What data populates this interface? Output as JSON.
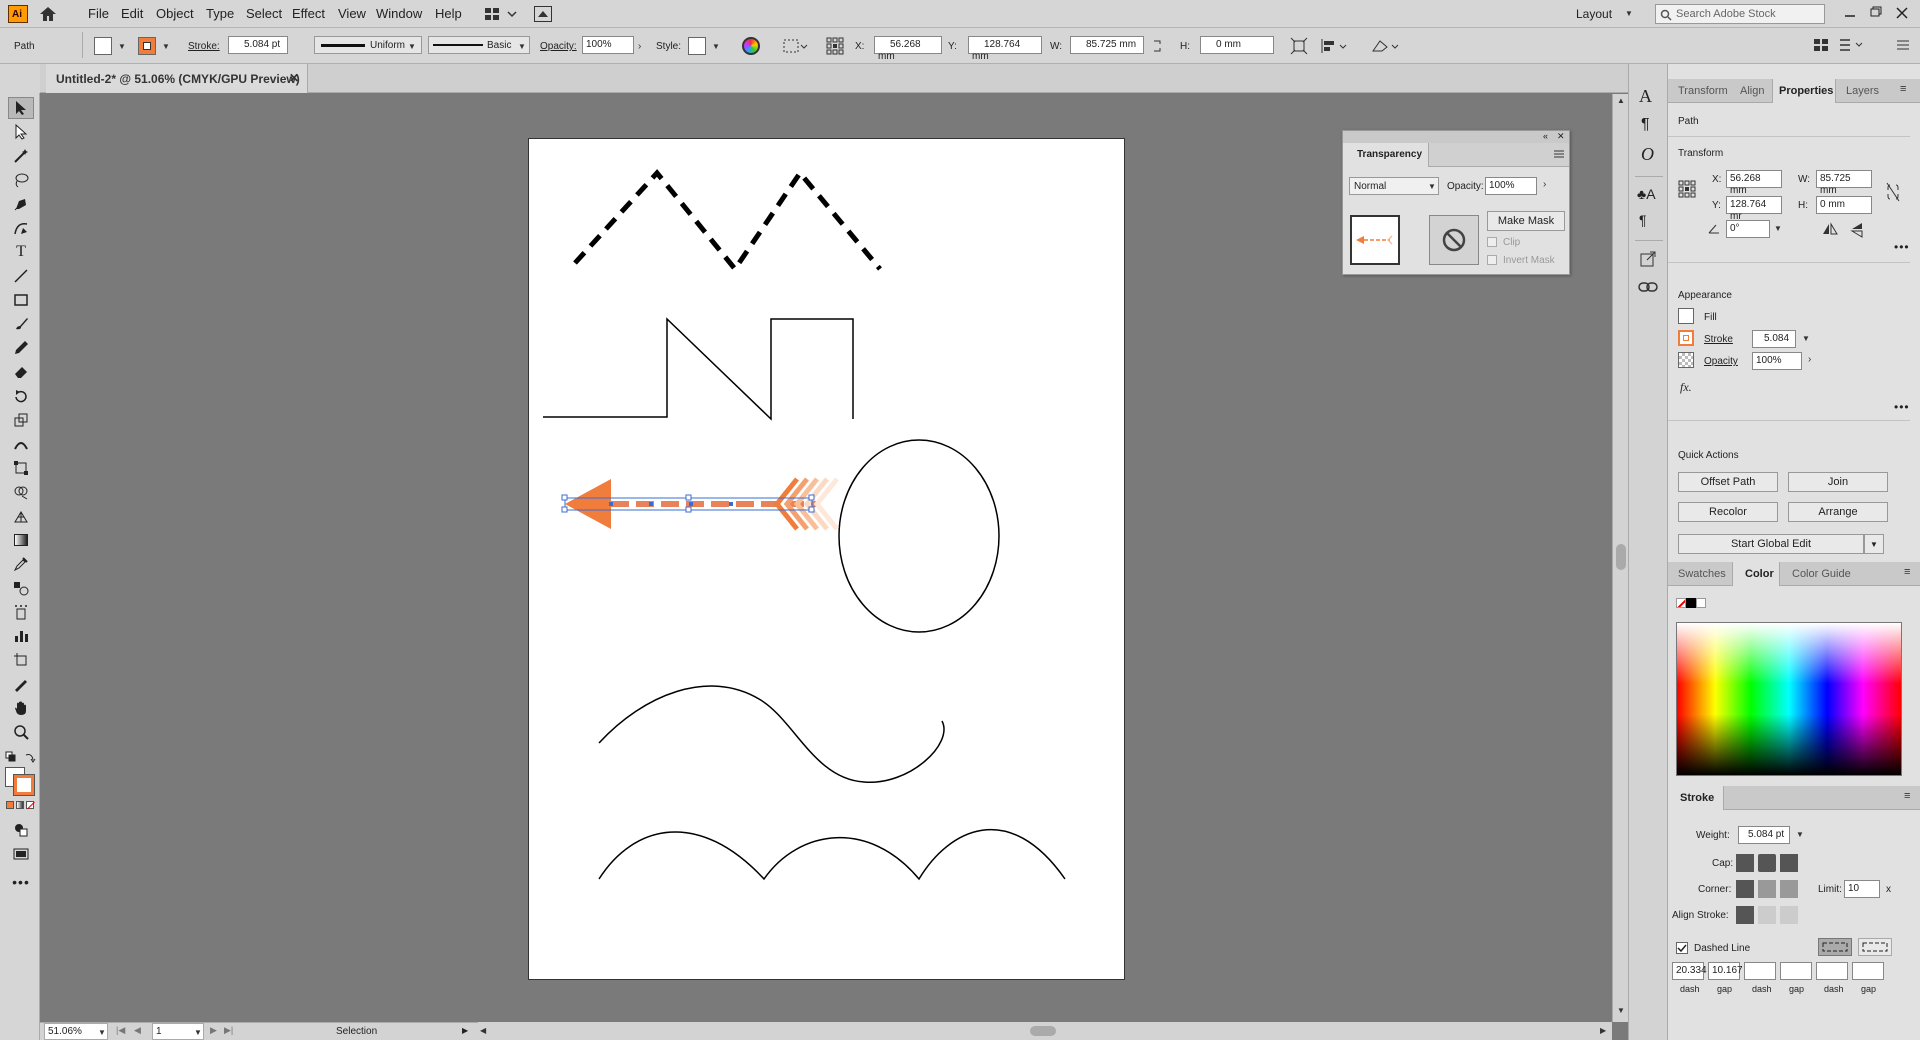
{
  "app": {
    "logo": "Ai"
  },
  "menu": [
    "File",
    "Edit",
    "Object",
    "Type",
    "Select",
    "Effect",
    "View",
    "Window",
    "Help"
  ],
  "layout": {
    "label": "Layout"
  },
  "search": {
    "placeholder": "Search Adobe Stock"
  },
  "control": {
    "object_type": "Path",
    "stroke_label": "Stroke:",
    "stroke_value": "5.084 pt",
    "profile_label": "Uniform",
    "brush_label": "Basic",
    "opacity_label": "Opacity:",
    "opacity_value": "100%",
    "style_label": "Style:",
    "x_label": "X:",
    "x_value": "56.268 mm",
    "y_label": "Y:",
    "y_value": "128.764 mm",
    "w_label": "W:",
    "w_value": "85.725 mm",
    "h_label": "H:",
    "h_value": "0 mm"
  },
  "document": {
    "tab_title": "Untitled-2* @ 51.06% (CMYK/GPU Preview)"
  },
  "status": {
    "zoom": "51.06%",
    "artboard": "1",
    "tool": "Selection"
  },
  "transparency": {
    "title": "Transparency",
    "blend_mode": "Normal",
    "opacity_label": "Opacity:",
    "opacity_value": "100%",
    "make_mask": "Make Mask",
    "clip": "Clip",
    "invert_mask": "Invert Mask"
  },
  "properties": {
    "tabs": [
      "Transform",
      "Align",
      "Properties",
      "Layers"
    ],
    "active_tab": "Properties",
    "object": "Path",
    "transform": {
      "title": "Transform",
      "x_label": "X:",
      "x": "56.268 mm",
      "y_label": "Y:",
      "y": "128.764 mr",
      "w_label": "W:",
      "w": "85.725 mm",
      "h_label": "H:",
      "h": "0 mm",
      "angle": "0°"
    },
    "appearance": {
      "title": "Appearance",
      "fill": "Fill",
      "stroke": "Stroke",
      "stroke_value": "5.084",
      "opacity": "Opacity",
      "opacity_value": "100%",
      "fx": "fx."
    },
    "quick_actions": {
      "title": "Quick Actions",
      "offset_path": "Offset Path",
      "join": "Join",
      "recolor": "Recolor",
      "arrange": "Arrange",
      "global_edit": "Start Global Edit"
    }
  },
  "color_panel": {
    "tabs": [
      "Swatches",
      "Color",
      "Color Guide"
    ],
    "active_tab": "Color"
  },
  "stroke_panel": {
    "title": "Stroke",
    "weight_label": "Weight:",
    "weight": "5.084 pt",
    "cap_label": "Cap:",
    "corner_label": "Corner:",
    "limit_label": "Limit:",
    "limit": "10",
    "limit_unit": "x",
    "align_label": "Align Stroke:",
    "dashed_label": "Dashed Line",
    "dash1": "20.334",
    "gap1": "10.167",
    "dash_labels": [
      "dash",
      "gap",
      "dash",
      "gap",
      "dash",
      "gap"
    ]
  },
  "colors": {
    "accent": "#f07d3c",
    "selection": "#3b6cd6"
  }
}
